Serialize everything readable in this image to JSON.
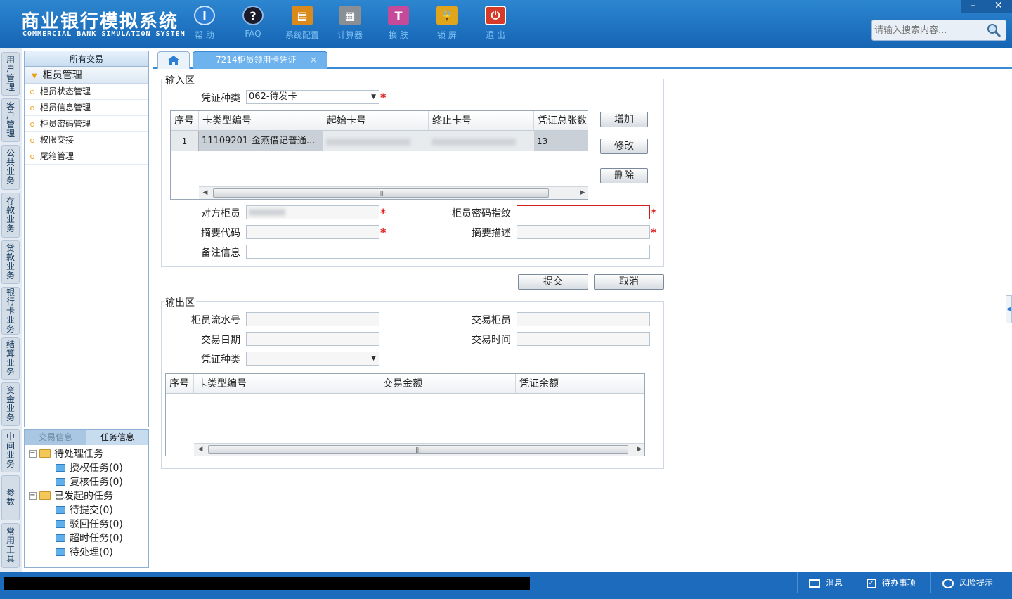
{
  "app": {
    "title_cn": "商业银行模拟系统",
    "title_en": "COMMERCIAL BANK SIMULATION SYSTEM"
  },
  "toolbar": [
    {
      "label": "帮 助",
      "icon": "info-icon",
      "color": "#2d7fd6"
    },
    {
      "label": "FAQ",
      "icon": "faq-icon",
      "color": "#1a1a2a"
    },
    {
      "label": "系统配置",
      "icon": "toolbox-icon",
      "color": "#d98a1a"
    },
    {
      "label": "计算器",
      "icon": "calculator-icon",
      "color": "#8a8f96"
    },
    {
      "label": "换 肤",
      "icon": "shirt-icon",
      "color": "#c64a9a"
    },
    {
      "label": "锁 屏",
      "icon": "lock-icon",
      "color": "#e0a51c"
    },
    {
      "label": "退 出",
      "icon": "power-icon",
      "color": "#d83a2a"
    }
  ],
  "window": {
    "minimize": "–",
    "close": "✕"
  },
  "search": {
    "placeholder": "请输入搜索内容..."
  },
  "side_tabs": [
    "用户管理",
    "客户管理",
    "公共业务",
    "存款业务",
    "贷款业务",
    "银行卡业务",
    "结算业务",
    "资金业务",
    "中间业务",
    "参数",
    "常用工具"
  ],
  "nav": {
    "header": "所有交易",
    "group": "柜员管理",
    "items": [
      "柜员状态管理",
      "柜员信息管理",
      "柜员密码管理",
      "权限交接",
      "尾箱管理"
    ]
  },
  "task_panel": {
    "tabs": [
      "交易信息",
      "任务信息"
    ],
    "tree": [
      {
        "label": "待处理任务",
        "level": 0
      },
      {
        "label": "授权任务(0)",
        "level": 1
      },
      {
        "label": "复核任务(0)",
        "level": 1
      },
      {
        "label": "已发起的任务",
        "level": 0
      },
      {
        "label": "待提交(0)",
        "level": 1
      },
      {
        "label": "驳回任务(0)",
        "level": 1
      },
      {
        "label": "超时任务(0)",
        "level": 1
      },
      {
        "label": "待处理(0)",
        "level": 1
      }
    ]
  },
  "tabs": {
    "current": "7214柜员领用卡凭证",
    "close": "×"
  },
  "input_area": {
    "legend": "输入区",
    "voucher_type_label": "凭证种类",
    "voucher_type_value": "062-待发卡",
    "grid": {
      "columns": [
        "序号",
        "卡类型编号",
        "起始卡号",
        "终止卡号",
        "凭证总张数"
      ],
      "rows": [
        {
          "seq": "1",
          "card_type": "11109201-金燕借记普通...",
          "total": "13"
        }
      ]
    },
    "buttons": {
      "add": "增加",
      "edit": "修改",
      "delete": "删除"
    },
    "fields": {
      "counterpart_label": "对方柜员",
      "pwd_label": "柜员密码指纹",
      "summary_code_label": "摘要代码",
      "summary_desc_label": "摘要描述",
      "remark_label": "备注信息"
    },
    "required_mark": "*"
  },
  "actions": {
    "submit": "提交",
    "cancel": "取消"
  },
  "output_area": {
    "legend": "输出区",
    "serial_label": "柜员流水号",
    "teller_label": "交易柜员",
    "date_label": "交易日期",
    "time_label": "交易时间",
    "voucher_type_label": "凭证种类",
    "grid": {
      "columns": [
        "序号",
        "卡类型编号",
        "交易金额",
        "凭证余额"
      ]
    }
  },
  "statusbar": {
    "message": "消息",
    "todo": "待办事项",
    "risk": "风险提示"
  }
}
